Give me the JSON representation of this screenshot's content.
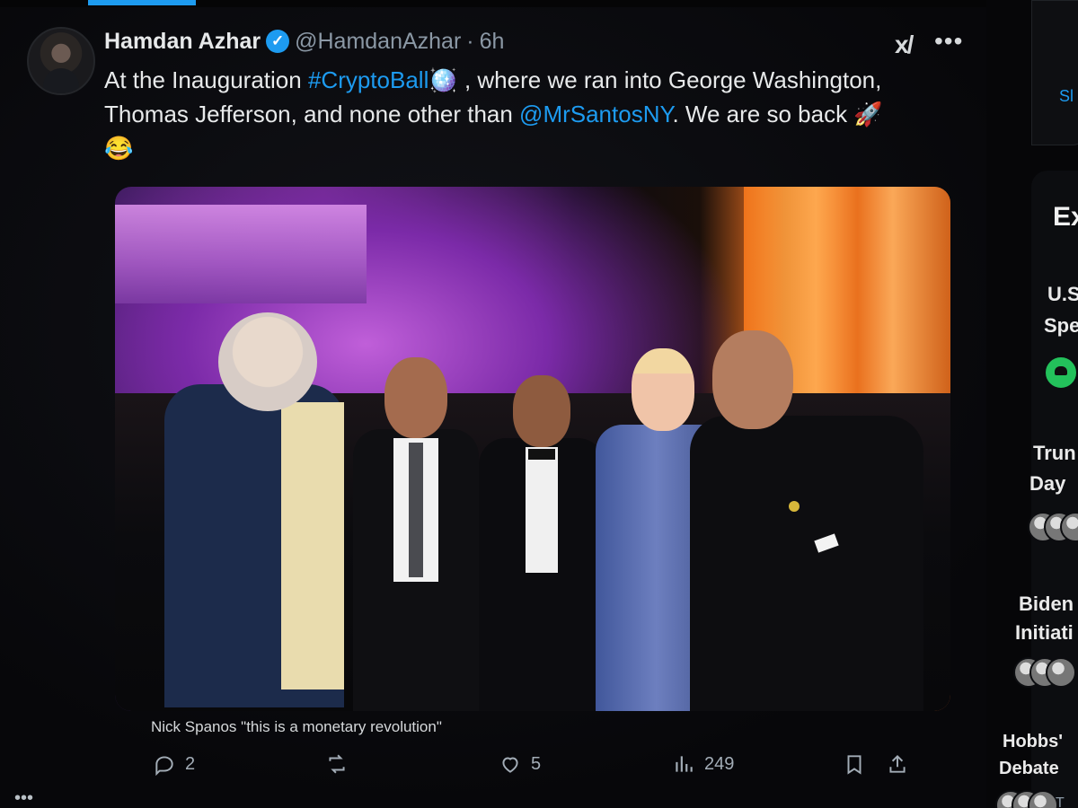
{
  "tweet": {
    "display_name": "Hamdan Azhar",
    "handle": "@HamdanAzhar",
    "separator": "·",
    "time": "6h",
    "text_prefix": "At the Inauguration ",
    "hashtag": "#CryptoBall",
    "text_mid": " , where we ran into George Washington, Thomas Jefferson, and none other than ",
    "mention": "@MrSantosNY",
    "text_suffix": ". We are so back ",
    "emoji_rocket": "🚀",
    "emoji_laugh": "😂",
    "emoji_ball": "🪩",
    "media_caption": "Nick Spanos \"this is a monetary revolution\"",
    "reply_count": "2",
    "like_count": "5",
    "view_count": "249"
  },
  "sidebar": {
    "top_card_label": "Sl",
    "section_title": "Ex",
    "items": [
      {
        "line1": "U.S",
        "line2": "Spe"
      },
      {
        "line1": "Trun",
        "line2": "Day"
      },
      {
        "line1": "Biden",
        "line2": "Initiati"
      },
      {
        "line1": "Hobbs'",
        "line2": "Debate"
      }
    ],
    "bottom_small_text": "T"
  },
  "icons": {
    "verified": "verified-badge-icon",
    "grok": "grok-icon",
    "more": "more-icon",
    "reply": "reply-icon",
    "retweet": "retweet-icon",
    "like": "like-icon",
    "views": "views-icon",
    "bookmark": "bookmark-icon",
    "share": "share-icon"
  },
  "colors": {
    "link": "#1d9bf0",
    "background": "#0a0a0c",
    "text": "#e7e9ea",
    "muted": "#8b98a5"
  },
  "ui": {
    "overflow_dots": "•••"
  }
}
